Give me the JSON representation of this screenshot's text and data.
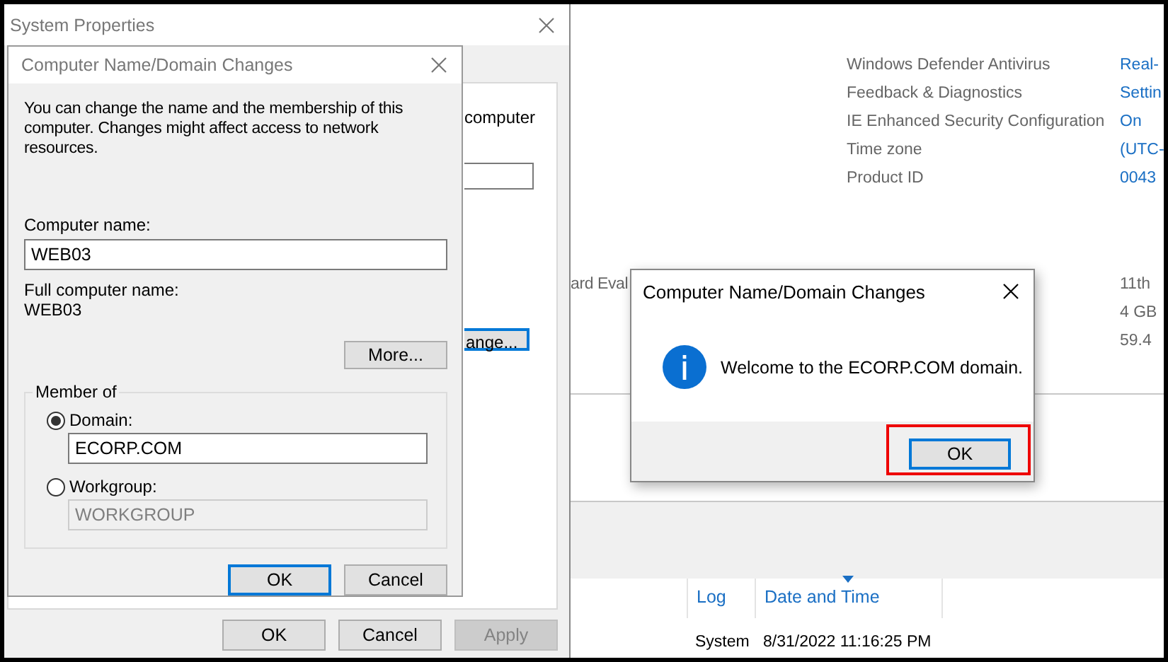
{
  "server_manager": {
    "properties": [
      {
        "label": "Windows Defender Antivirus",
        "value": "Real-"
      },
      {
        "label": "Feedback & Diagnostics",
        "value": "Settin"
      },
      {
        "label": "IE Enhanced Security Configuration",
        "value": "On"
      },
      {
        "label": "Time zone",
        "value": "(UTC-"
      },
      {
        "label": "Product ID",
        "value": "0043"
      }
    ],
    "edition_fragment": "ard Eval",
    "hardware_values": [
      "11th",
      "4 GB",
      "59.4"
    ],
    "events": {
      "columns": [
        {
          "label": "Log",
          "sorted": false
        },
        {
          "label": "Date and Time",
          "sorted": true
        }
      ],
      "rows": [
        {
          "log": "System",
          "date_time": "8/31/2022 11:16:25 PM"
        }
      ]
    }
  },
  "system_properties": {
    "title": "System Properties",
    "tab_text_fragment": "computer",
    "change_button_fragment": "ange...",
    "buttons": [
      {
        "label": "OK",
        "disabled": false
      },
      {
        "label": "Cancel",
        "disabled": false
      },
      {
        "label": "Apply",
        "disabled": true
      }
    ]
  },
  "domain_changes_dialog": {
    "title": "Computer Name/Domain Changes",
    "description": "You can change the name and the membership of this computer. Changes might affect access to network resources.",
    "computer_name_label": "Computer name:",
    "computer_name_value": "WEB03",
    "full_name_label": "Full computer name:",
    "full_name_value": "WEB03",
    "more_button": "More...",
    "member_of": {
      "legend": "Member of",
      "options": [
        {
          "label": "Domain:",
          "selected": true,
          "value": "ECORP.COM",
          "disabled": false
        },
        {
          "label": "Workgroup:",
          "selected": false,
          "value": "WORKGROUP",
          "disabled": true
        }
      ]
    },
    "buttons": [
      {
        "label": "OK",
        "default": true
      },
      {
        "label": "Cancel",
        "default": false
      }
    ]
  },
  "message_box": {
    "title": "Computer Name/Domain Changes",
    "message": "Welcome to the ECORP.COM domain.",
    "ok_button": "OK",
    "highlighted": true
  }
}
